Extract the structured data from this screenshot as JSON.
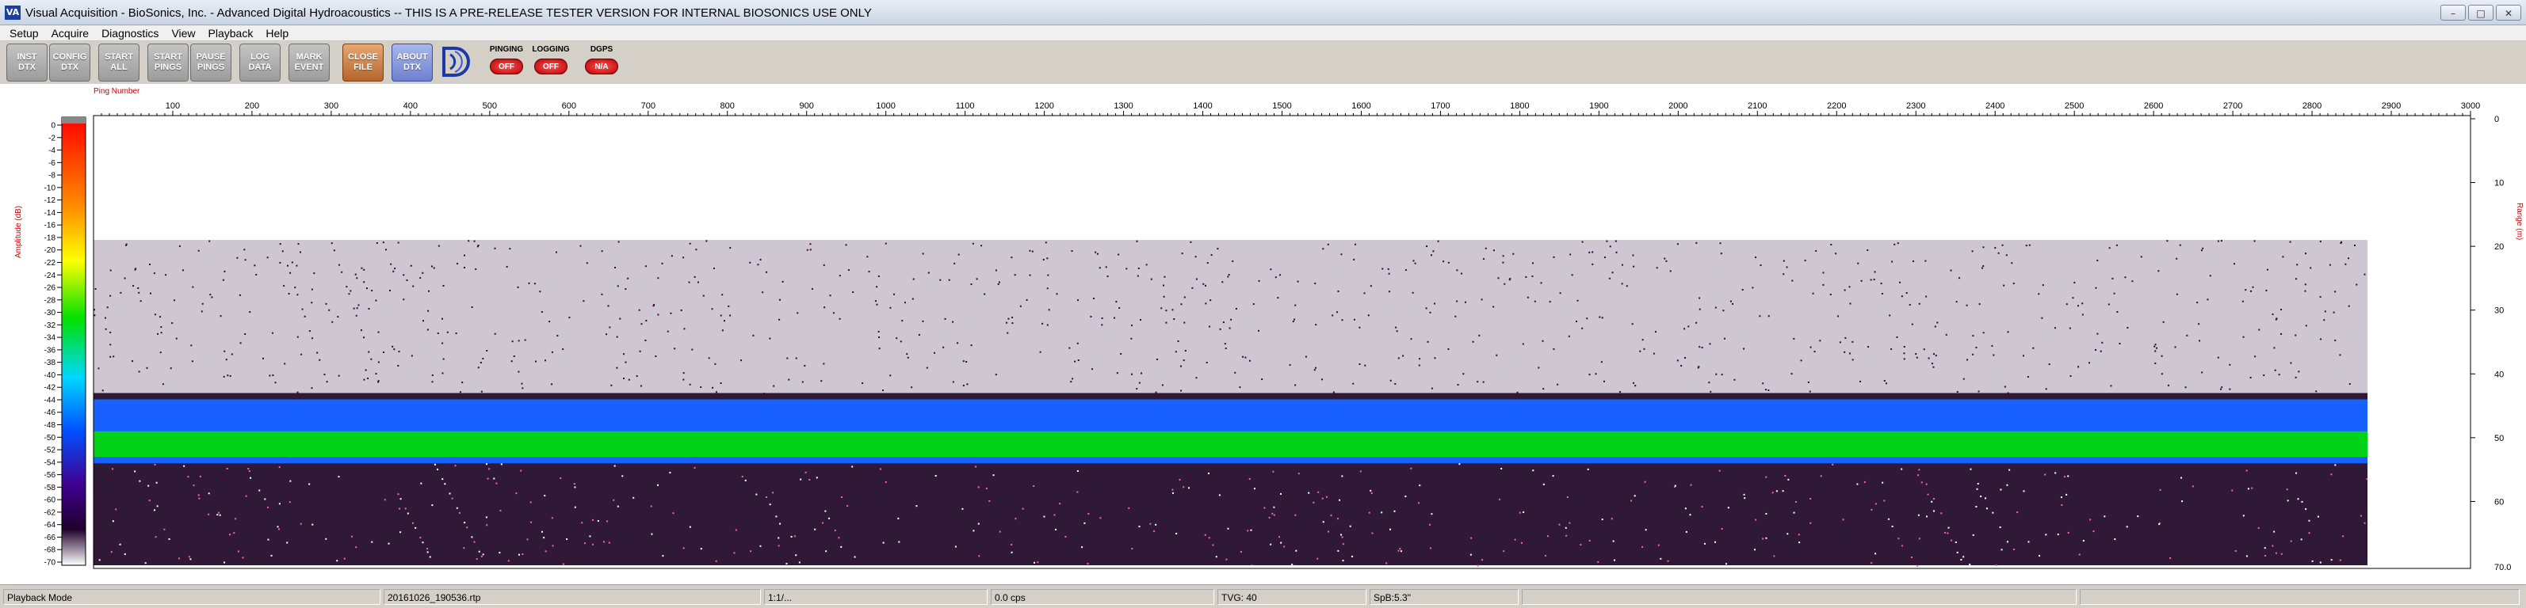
{
  "window": {
    "title": "Visual Acquisition  -  BioSonics, Inc.  -  Advanced Digital Hydroacoustics  --  THIS IS A PRE-RELEASE TESTER VERSION FOR INTERNAL BIOSONICS USE ONLY",
    "app_icon_text": "VA",
    "controls": [
      "–",
      "□",
      "✕"
    ]
  },
  "menu": [
    "Setup",
    "Acquire",
    "Diagnostics",
    "View",
    "Playback",
    "Help"
  ],
  "toolbar": {
    "buttons": [
      {
        "id": "inst-dtx",
        "label": "INST\nDTX"
      },
      {
        "id": "config-dtx",
        "label": "CONFIG\nDTX"
      },
      {
        "id": "start-all",
        "label": "START\nALL"
      },
      {
        "id": "start-pings",
        "label": "START\nPINGS"
      },
      {
        "id": "pause-pings",
        "label": "PAUSE\nPINGS"
      },
      {
        "id": "log-data",
        "label": "LOG\nDATA"
      },
      {
        "id": "mark-event",
        "label": "MARK\nEVENT"
      },
      {
        "id": "close-file",
        "label": "CLOSE\nFILE"
      },
      {
        "id": "about-dtx",
        "label": "ABOUT\nDTX"
      }
    ],
    "status": [
      {
        "id": "pinging",
        "label": "PINGING",
        "value": "OFF"
      },
      {
        "id": "logging",
        "label": "LOGGING",
        "value": "OFF"
      },
      {
        "id": "dgps",
        "label": "DGPS",
        "value": "N/A"
      }
    ]
  },
  "statusbar": {
    "mode": "Playback Mode",
    "file": "20161026_190536.rtp",
    "ratio": "1:1/...",
    "cps": "0.0 cps",
    "tvg": "TVG: 40",
    "spb": "SpB:5.3\""
  },
  "chart_data": {
    "type": "heatmap",
    "title": "",
    "x_axis": {
      "label": "Ping Number",
      "min": 0,
      "max": 3000,
      "ticks": [
        100,
        200,
        300,
        400,
        500,
        600,
        700,
        800,
        900,
        1000,
        1100,
        1200,
        1300,
        1400,
        1500,
        1600,
        1700,
        1800,
        1900,
        2000,
        2100,
        2200,
        2300,
        2400,
        2500,
        2600,
        2700,
        2800,
        2900,
        3000
      ]
    },
    "y_axis": {
      "label": "Range (m)",
      "min": 0,
      "max": 70,
      "ticks": [
        0,
        10,
        20,
        30,
        40,
        50,
        60
      ],
      "end_label": "70.0"
    },
    "color_scale": {
      "label": "Amplitude (dB)",
      "min": -70,
      "max": 0,
      "ticks": [
        0,
        -2,
        -4,
        -6,
        -8,
        -10,
        -12,
        -14,
        -16,
        -18,
        -20,
        -22,
        -24,
        -26,
        -28,
        -30,
        -32,
        -34,
        -36,
        -38,
        -40,
        -42,
        -44,
        -46,
        -48,
        -50,
        -52,
        -54,
        -56,
        -58,
        -60,
        -62,
        -64,
        -66,
        -68,
        -70
      ]
    },
    "data_extent_pings": 2870,
    "layers": [
      {
        "name": "sparse scatter",
        "range_from_m": 19,
        "range_to_m": 43,
        "amplitude_db": -62
      },
      {
        "name": "bottom echo",
        "range_from_m": 43,
        "range_to_m": 44,
        "amplitude_db": -66
      },
      {
        "name": "strong layer",
        "range_from_m": 44,
        "range_to_m": 54,
        "amplitude_db": -42
      },
      {
        "name": "peak band",
        "range_from_m": 49,
        "range_to_m": 53,
        "amplitude_db": -28
      },
      {
        "name": "deep noise",
        "range_from_m": 54,
        "range_to_m": 70,
        "amplitude_db": -66
      }
    ]
  }
}
